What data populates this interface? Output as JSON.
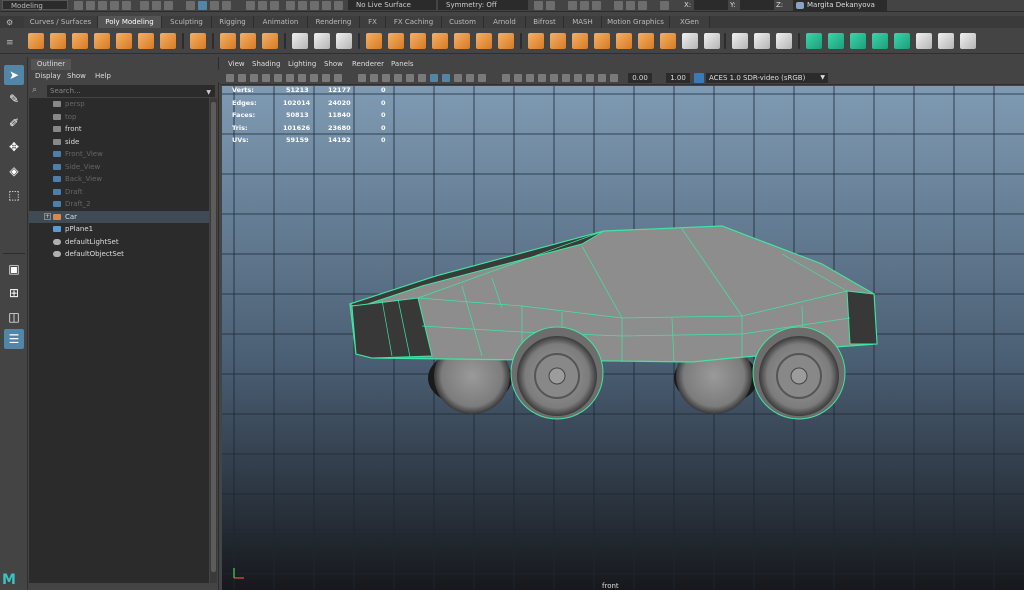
{
  "status_line": {
    "mode": "Modeling",
    "live_surface": "No Live Surface",
    "symmetry": "Symmetry: Off",
    "x_label": "X:",
    "y_label": "Y:",
    "z_label": "Z:",
    "user": "Margita Dekanyova"
  },
  "shelf_tabs": [
    {
      "label": "Curves / Surfaces",
      "active": false
    },
    {
      "label": "Poly Modeling",
      "active": true
    },
    {
      "label": "Sculpting",
      "active": false
    },
    {
      "label": "Rigging",
      "active": false
    },
    {
      "label": "Animation",
      "active": false
    },
    {
      "label": "Rendering",
      "active": false
    },
    {
      "label": "FX",
      "active": false
    },
    {
      "label": "FX Caching",
      "active": false
    },
    {
      "label": "Custom",
      "active": false
    },
    {
      "label": "Arnold",
      "active": false
    },
    {
      "label": "Bifrost",
      "active": false
    },
    {
      "label": "MASH",
      "active": false
    },
    {
      "label": "Motion Graphics",
      "active": false
    },
    {
      "label": "XGen",
      "active": false
    }
  ],
  "outliner": {
    "tab": "Outliner",
    "menu": [
      "Display",
      "Show",
      "Help"
    ],
    "search_placeholder": "Search...",
    "items": [
      {
        "label": "persp",
        "state": "dim"
      },
      {
        "label": "top",
        "state": "dim"
      },
      {
        "label": "front",
        "state": "norm"
      },
      {
        "label": "side",
        "state": "norm"
      },
      {
        "label": "Front_View",
        "state": "dim"
      },
      {
        "label": "Side_View",
        "state": "dim"
      },
      {
        "label": "Back_View",
        "state": "dim"
      },
      {
        "label": "Draft",
        "state": "dim"
      },
      {
        "label": "Draft_2",
        "state": "dim"
      },
      {
        "label": "Car",
        "state": "sel"
      },
      {
        "label": "pPlane1",
        "state": "norm"
      },
      {
        "label": "defaultLightSet",
        "state": "norm"
      },
      {
        "label": "defaultObjectSet",
        "state": "norm"
      }
    ]
  },
  "viewport": {
    "menu": [
      "View",
      "Shading",
      "Lighting",
      "Show",
      "Renderer",
      "Panels"
    ],
    "exposure": "0.00",
    "gamma": "1.00",
    "color_management": "ACES 1.0 SDR-video (sRGB)",
    "camera": "front",
    "stats": [
      {
        "label": "Verts:",
        "total": "51213",
        "selected": "12177",
        "components": "0"
      },
      {
        "label": "Edges:",
        "total": "102014",
        "selected": "24020",
        "components": "0"
      },
      {
        "label": "Faces:",
        "total": "50813",
        "selected": "11840",
        "components": "0"
      },
      {
        "label": "Tris:",
        "total": "101626",
        "selected": "23680",
        "components": "0"
      },
      {
        "label": "UVs:",
        "total": "59159",
        "selected": "14192",
        "components": "0"
      }
    ]
  },
  "colors": {
    "accent": "#5285a6",
    "wire_selected": "#3fe5a0",
    "shelf_orange": "#e3913b"
  }
}
